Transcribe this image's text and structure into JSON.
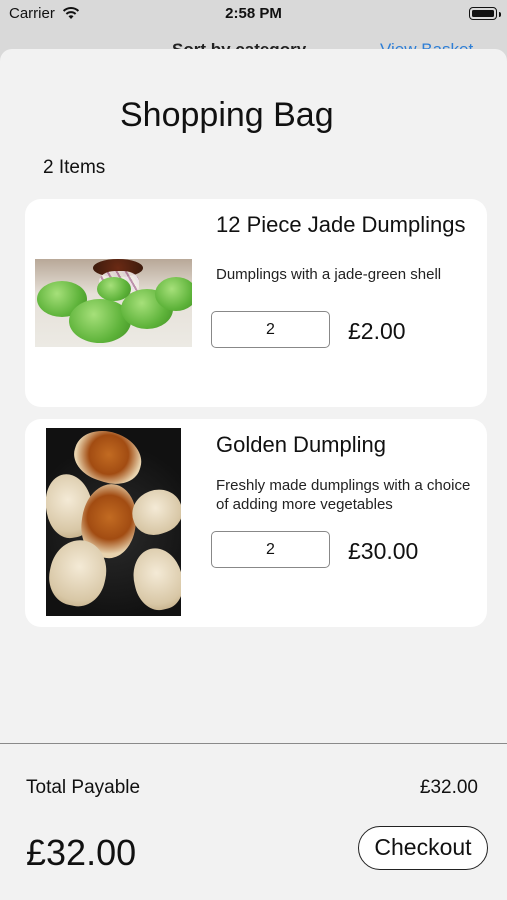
{
  "status_bar": {
    "carrier": "Carrier",
    "time": "2:58 PM"
  },
  "background_nav": {
    "left_text": "Sort by category",
    "right_text": "View Basket"
  },
  "sheet": {
    "title": "Shopping Bag",
    "item_count": "2 Items"
  },
  "cart": {
    "items": [
      {
        "title": "12 Piece Jade Dumplings",
        "description": "Dumplings with a jade-green shell",
        "quantity": "2",
        "price": "£2.00"
      },
      {
        "title": "Golden Dumpling",
        "description": "Freshly made dumplings with a choice of adding more vegetables",
        "quantity": "2",
        "price": "£30.00"
      }
    ]
  },
  "footer": {
    "total_label": "Total Payable",
    "total_small": "£32.00",
    "total_large": "£32.00",
    "checkout_label": "Checkout"
  },
  "colors": {
    "link_blue": "#2f7fd6",
    "sheet_bg": "#f2f2f2",
    "card_bg": "#ffffff"
  }
}
